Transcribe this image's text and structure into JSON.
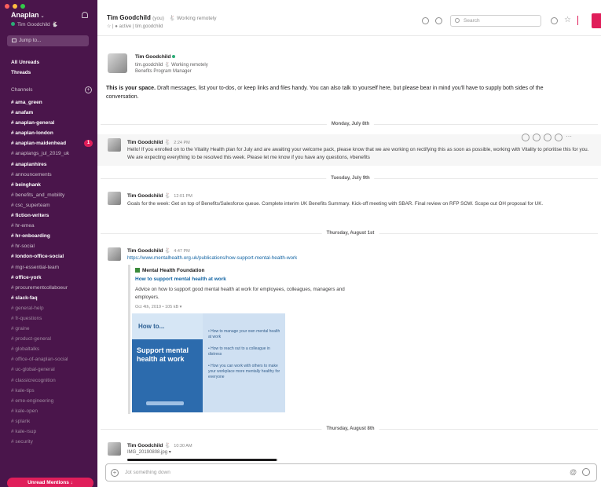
{
  "sidebar": {
    "workspace_name": "Anaplan",
    "workspace_caret": "⌄",
    "current_user": "Tim Goodchild",
    "user_emoji": "🐇",
    "jump_to": "Jump to...",
    "all_threads": "All Unreads",
    "threads": "Threads",
    "channels_label": "Channels",
    "add_glyph": "+",
    "channels": [
      {
        "name": "# ama_green",
        "style": "unread"
      },
      {
        "name": "# anafam",
        "style": "unread"
      },
      {
        "name": "# anaplan-general",
        "style": "unread"
      },
      {
        "name": "# anaplan-london",
        "style": "unread"
      },
      {
        "name": "# anaplan-maidenhead",
        "style": "unread",
        "badge": "1"
      },
      {
        "name": "# anaplangs_jul_2019_uk",
        "style": "normal"
      },
      {
        "name": "# anaplanhires",
        "style": "unread"
      },
      {
        "name": "# announcements",
        "style": "normal"
      },
      {
        "name": "# beinghank",
        "style": "unread"
      },
      {
        "name": "# benefits_and_mobility",
        "style": "normal"
      },
      {
        "name": "# csc_superteam",
        "style": "normal"
      },
      {
        "name": "# fiction-writers",
        "style": "unread"
      },
      {
        "name": "# hr-emea",
        "style": "normal"
      },
      {
        "name": "# hr-onboarding",
        "style": "unread"
      },
      {
        "name": "# hr-social",
        "style": "normal"
      },
      {
        "name": "# london-office-social",
        "style": "unread"
      },
      {
        "name": "# mgr-essential-team",
        "style": "normal"
      },
      {
        "name": "# office-york",
        "style": "unread"
      },
      {
        "name": "# procurementcollaboeur",
        "style": "normal"
      },
      {
        "name": "# slack-faq",
        "style": "unread"
      },
      {
        "name": "# general-help",
        "style": "muted"
      },
      {
        "name": "# fr-questions",
        "style": "muted"
      },
      {
        "name": "# graine",
        "style": "muted"
      },
      {
        "name": "# product-general",
        "style": "muted"
      },
      {
        "name": "# globaltalks",
        "style": "muted"
      },
      {
        "name": "# office-of-anaplan-social",
        "style": "muted"
      },
      {
        "name": "# uc-global-general",
        "style": "muted"
      },
      {
        "name": "# classicrecognition",
        "style": "muted"
      },
      {
        "name": "# kale-tips",
        "style": "muted"
      },
      {
        "name": "# eme-engineering",
        "style": "muted"
      },
      {
        "name": "# kale-open",
        "style": "muted"
      },
      {
        "name": "# splank",
        "style": "muted"
      },
      {
        "name": "# kale-rsup",
        "style": "muted"
      },
      {
        "name": "# security",
        "style": "muted"
      }
    ],
    "unread_button": "Unread Mentions ↓"
  },
  "header": {
    "title": "Tim Goodchild",
    "you_tag": "(you)",
    "status": "🐇 Working remotely",
    "subline": "☆ | ● active | tim.goodchild",
    "search_placeholder": "Search"
  },
  "intro": {
    "name": "Tim Goodchild",
    "handle": "tim.goodchild  🐇 Working remotely",
    "role": "Benefits Program Manager",
    "space_bold": "This is your space.",
    "space_text": " Draft messages, list your to-dos, or keep links and files handy. You can also talk to yourself here, but please bear in mind you'll have to supply both sides of the conversation."
  },
  "dividers": {
    "d1": "Monday, July 8th",
    "d2": "Tuesday, July 9th",
    "d3": "Thursday, August 1st",
    "d4": "Thursday, August 8th"
  },
  "messages": {
    "m1": {
      "name": "Tim Goodchild 🐇",
      "time": "2:24 PM",
      "body": "Hello! If you enrolled on to the Vitality Health plan for July and are awaiting your welcome pack, please know that we are working on rectifying this as soon as possible, working with Vitality to prioritise this for you. We are expecting everything to be resolved this week. Please let me know if you have any questions, #benefits"
    },
    "m2": {
      "name": "Tim Goodchild 🐇",
      "time": "12:01 PM",
      "body": "Goals for the week: Get on top of Benefits/Salesforce queue. Complete interim UK Benefits Summary. Kick-off meeting with SBAR. Final review on RFP SOW. Scope out OH proposal for UK."
    },
    "m3": {
      "name": "Tim Goodchild 🐇",
      "time": "4:47 PM",
      "link": "https://www.mentalhealth.org.uk/publications/how-support-mental-health-work"
    },
    "m4": {
      "name": "Tim Goodchild 🐇",
      "time": "10:30 AM",
      "file": "IMG_20190808.jpg ▾",
      "progress_fraction": 0.99
    }
  },
  "unfurl": {
    "site": "Mental Health Foundation",
    "title": "How to support mental health at work",
    "desc": "Advice on how to support good mental health at work for employees, colleagues, managers and employers.",
    "size": "Oct 4th, 2019 • 105 kB ▾",
    "promo_how": "How to...",
    "promo_headline": "Support mental health at work",
    "promo_items": [
      "• How to manage your own mental health at work",
      "• How to reach out to a colleague in distress",
      "• How you can work with others to make your workplace more mentally healthy for everyone"
    ]
  },
  "composer": {
    "plus": "+",
    "placeholder": "Jot something down",
    "at": "@"
  },
  "colors": {
    "sidebar_bg": "#4a154b",
    "accent": "#e01e5a",
    "link": "#1264a3",
    "presence": "#2bac76"
  }
}
